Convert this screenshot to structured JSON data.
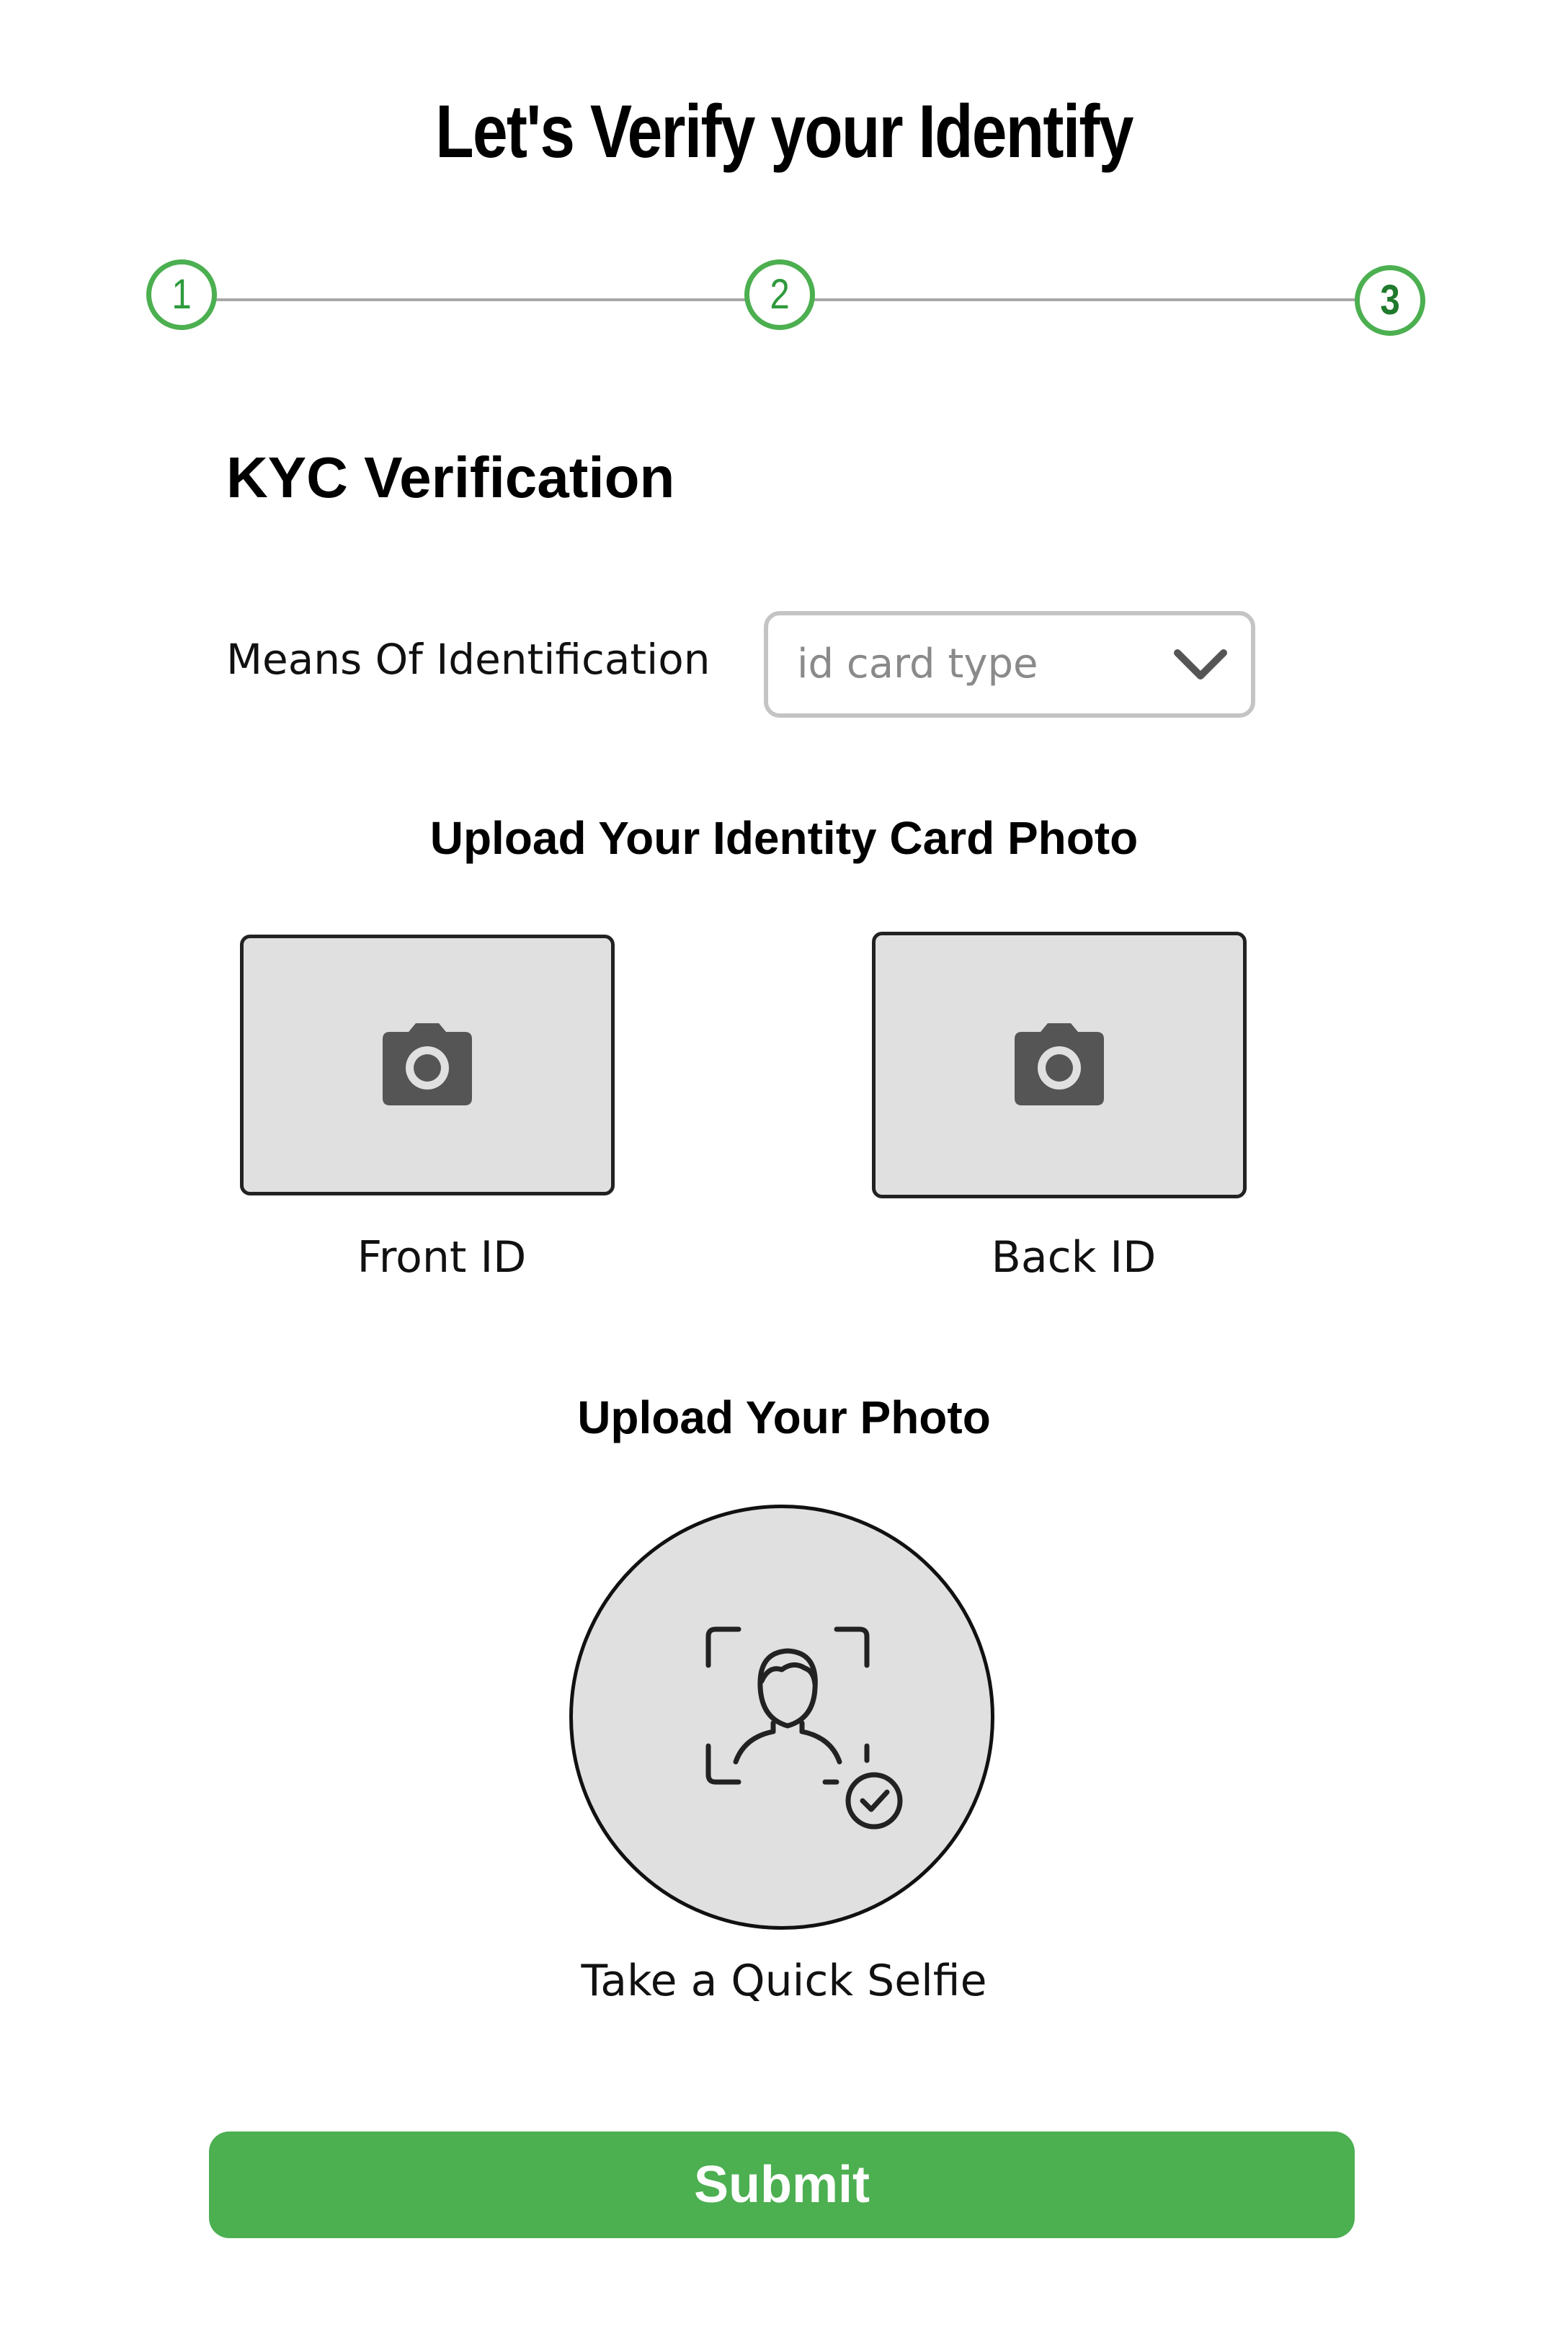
{
  "page": {
    "title": "Let's Verify your Identify"
  },
  "stepper": {
    "steps": [
      "1",
      "2",
      "3"
    ],
    "current_step": 3,
    "color": "#4caf50"
  },
  "kyc": {
    "section_title": "KYC Verification",
    "means_label": "Means Of Identification",
    "id_type_select": {
      "placeholder": "id card type",
      "icon": "chevron-down-icon"
    }
  },
  "id_upload": {
    "heading": "Upload Your Identity Card Photo",
    "front": {
      "label": "Front ID",
      "icon": "camera-icon"
    },
    "back": {
      "label": "Back ID",
      "icon": "camera-icon"
    }
  },
  "photo_upload": {
    "heading": "Upload Your Photo",
    "selfie_label": "Take a Quick Selfie",
    "icon": "face-scan-check-icon"
  },
  "actions": {
    "submit_label": "Submit",
    "submit_color": "#4caf50"
  }
}
